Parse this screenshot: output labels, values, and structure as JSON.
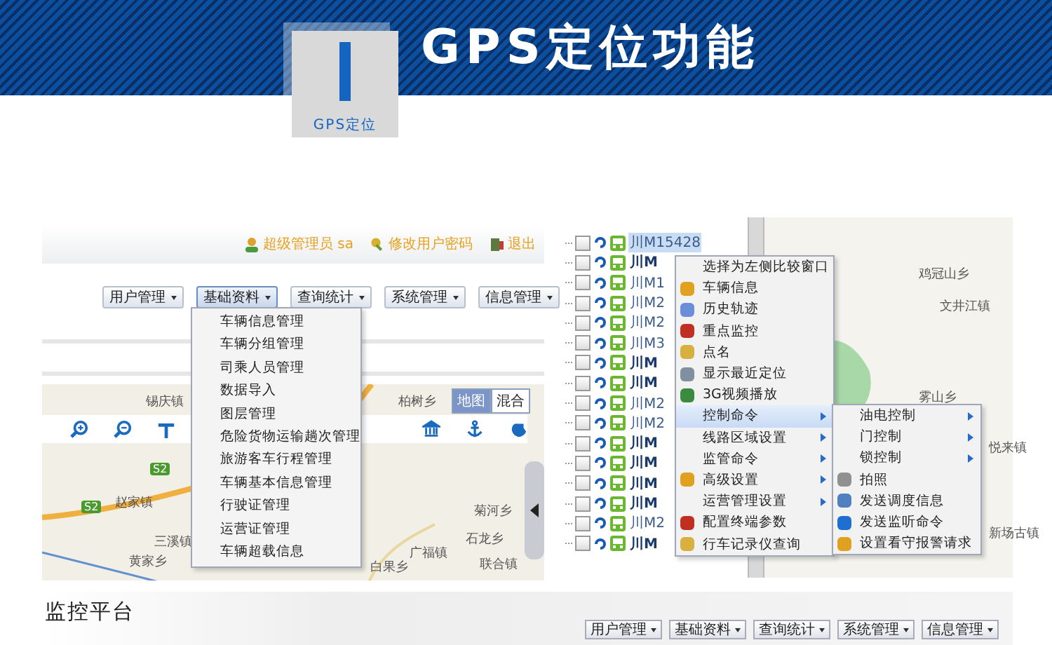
{
  "header": {
    "title": "GPS定位功能",
    "badge_label": "GPS定位"
  },
  "left_screenshot": {
    "user_links": [
      {
        "label": "超级管理员 sa"
      },
      {
        "label": "修改用户密码"
      },
      {
        "label": "退出"
      }
    ],
    "menus": [
      {
        "label": "用户管理",
        "selected": false
      },
      {
        "label": "基础资料",
        "selected": true
      },
      {
        "label": "查询统计",
        "selected": false
      },
      {
        "label": "系统管理",
        "selected": false
      },
      {
        "label": "信息管理",
        "selected": false
      }
    ],
    "dropdown": [
      "车辆信息管理",
      "车辆分组管理",
      "司乘人员管理",
      "数据导入",
      "图层管理",
      "危险货物运输趟次管理",
      "旅游客车行程管理",
      "车辆基本信息管理",
      "行驶证管理",
      "运营证管理",
      "车辆超载信息"
    ],
    "map_toggle": [
      {
        "label": "地图",
        "selected": true
      },
      {
        "label": "混合",
        "selected": false
      }
    ],
    "map_labels": [
      "锡庆镇",
      "柏树乡",
      "赵家镇",
      "三溪镇",
      "黄家乡",
      "菊河乡",
      "石龙乡",
      "广福镇",
      "白果乡",
      "联合镇"
    ],
    "road_badges": [
      "S2",
      "S2"
    ]
  },
  "right_screenshot": {
    "vehicles": [
      {
        "plate": "川M15428",
        "selected": true,
        "online": false,
        "checked": false
      },
      {
        "plate": "川M",
        "selected": false,
        "online": true,
        "checked": false
      },
      {
        "plate": "川M1",
        "selected": false,
        "online": false,
        "checked": false
      },
      {
        "plate": "川M2",
        "selected": false,
        "online": false,
        "checked": false
      },
      {
        "plate": "川M2",
        "selected": false,
        "online": false,
        "checked": false
      },
      {
        "plate": "川M3",
        "selected": false,
        "online": false,
        "checked": false
      },
      {
        "plate": "川M",
        "selected": false,
        "online": true,
        "checked": false
      },
      {
        "plate": "川M",
        "selected": false,
        "online": true,
        "checked": false
      },
      {
        "plate": "川M2",
        "selected": false,
        "online": false,
        "checked": false
      },
      {
        "plate": "川M2",
        "selected": false,
        "online": false,
        "checked": false
      },
      {
        "plate": "川M",
        "selected": false,
        "online": true,
        "checked": false
      },
      {
        "plate": "川M",
        "selected": false,
        "online": true,
        "checked": false
      },
      {
        "plate": "川M",
        "selected": false,
        "online": true,
        "checked": false
      },
      {
        "plate": "川M",
        "selected": false,
        "online": true,
        "checked": false
      },
      {
        "plate": "川M2",
        "selected": false,
        "online": false,
        "checked": false
      },
      {
        "plate": "川M",
        "selected": false,
        "online": true,
        "checked": false
      }
    ],
    "context_menu": [
      {
        "label": "选择为左侧比较窗口",
        "has_icon": false,
        "submenu": false,
        "selected": false
      },
      {
        "label": "车辆信息",
        "has_icon": true,
        "submenu": false,
        "selected": false
      },
      {
        "label": "历史轨迹",
        "has_icon": true,
        "submenu": false,
        "selected": false
      },
      {
        "label": "重点监控",
        "has_icon": true,
        "submenu": false,
        "selected": false
      },
      {
        "label": "点名",
        "has_icon": true,
        "submenu": false,
        "selected": false
      },
      {
        "label": "显示最近定位",
        "has_icon": true,
        "submenu": false,
        "selected": false
      },
      {
        "label": "3G视频播放",
        "has_icon": true,
        "submenu": false,
        "selected": false
      },
      {
        "label": "控制命令",
        "has_icon": false,
        "submenu": true,
        "selected": true
      },
      {
        "label": "线路区域设置",
        "has_icon": false,
        "submenu": true,
        "selected": false
      },
      {
        "label": "监管命令",
        "has_icon": false,
        "submenu": true,
        "selected": false
      },
      {
        "label": "高级设置",
        "has_icon": true,
        "submenu": true,
        "selected": false
      },
      {
        "label": "运营管理设置",
        "has_icon": false,
        "submenu": true,
        "selected": false
      },
      {
        "label": "配置终端参数",
        "has_icon": true,
        "submenu": false,
        "selected": false
      },
      {
        "label": "行车记录仪查询",
        "has_icon": true,
        "submenu": false,
        "selected": false
      }
    ],
    "submenu": [
      {
        "label": "油电控制",
        "has_icon": false,
        "submenu": true
      },
      {
        "label": "门控制",
        "has_icon": false,
        "submenu": true
      },
      {
        "label": "锁控制",
        "has_icon": false,
        "submenu": true
      },
      {
        "label": "拍照",
        "has_icon": true,
        "submenu": false
      },
      {
        "label": "发送调度信息",
        "has_icon": true,
        "submenu": false
      },
      {
        "label": "发送监听命令",
        "has_icon": true,
        "submenu": false
      },
      {
        "label": "设置看守报警请求",
        "has_icon": true,
        "submenu": false
      }
    ],
    "map_labels": [
      "鸡冠山乡",
      "文井江镇",
      "雾山乡",
      "悦来镇",
      "新场古镇"
    ]
  },
  "bottom_strip": {
    "title": "监控平台",
    "menus": [
      "用户管理",
      "基础资料",
      "查询统计",
      "系统管理",
      "信息管理"
    ]
  }
}
